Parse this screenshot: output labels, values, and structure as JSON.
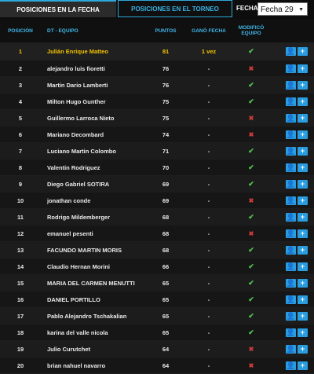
{
  "tabs": [
    {
      "label": "POSICIONES EN LA FECHA",
      "active": true
    },
    {
      "label": "POSICIONES EN EL TORNEO",
      "active": false
    }
  ],
  "fecha": {
    "label": "FECHA:",
    "selected": "Fecha 29"
  },
  "columns": {
    "posicion": "POSICIÓN",
    "equipo": "DT - EQUIPO",
    "puntos": "PUNTOS",
    "gano_fecha": "GANÓ FECHA",
    "modifico_equipo": "MODIFICÓ EQUIPO"
  },
  "colors": {
    "accent": "#2ea7d9",
    "leader": "#f2c200",
    "check": "#4ec54e",
    "cross": "#d23a3a"
  },
  "rows": [
    {
      "pos": "1",
      "name": "Julián Enrique Matteo",
      "pts": "81",
      "gano": "1 vez",
      "mod": "check"
    },
    {
      "pos": "2",
      "name": "alejandro luis fioretti",
      "pts": "76",
      "gano": "-",
      "mod": "cross"
    },
    {
      "pos": "3",
      "name": "Martin Dario Lamberti",
      "pts": "76",
      "gano": "-",
      "mod": "check"
    },
    {
      "pos": "4",
      "name": "Milton Hugo Gunther",
      "pts": "75",
      "gano": "-",
      "mod": "check"
    },
    {
      "pos": "5",
      "name": "Guillermo Larroca Nieto",
      "pts": "75",
      "gano": "-",
      "mod": "cross"
    },
    {
      "pos": "6",
      "name": "Mariano Decombard",
      "pts": "74",
      "gano": "-",
      "mod": "cross"
    },
    {
      "pos": "7",
      "name": "Luciano Martin Colombo",
      "pts": "71",
      "gano": "-",
      "mod": "check"
    },
    {
      "pos": "8",
      "name": "Valentin Rodriguez",
      "pts": "70",
      "gano": "-",
      "mod": "check"
    },
    {
      "pos": "9",
      "name": "Diego Gabriel SOTIRA",
      "pts": "69",
      "gano": "-",
      "mod": "check"
    },
    {
      "pos": "10",
      "name": "jonathan conde",
      "pts": "69",
      "gano": "-",
      "mod": "cross"
    },
    {
      "pos": "11",
      "name": "Rodrigo Mildemberger",
      "pts": "68",
      "gano": "-",
      "mod": "check"
    },
    {
      "pos": "12",
      "name": "emanuel pesenti",
      "pts": "68",
      "gano": "-",
      "mod": "cross"
    },
    {
      "pos": "13",
      "name": "FACUNDO MARTIN MORIS",
      "pts": "68",
      "gano": "-",
      "mod": "check"
    },
    {
      "pos": "14",
      "name": "Claudio Hernan Morini",
      "pts": "66",
      "gano": "-",
      "mod": "check"
    },
    {
      "pos": "15",
      "name": "MARIA DEL CARMEN MENUTTI",
      "pts": "65",
      "gano": "-",
      "mod": "check"
    },
    {
      "pos": "16",
      "name": "DANIEL PORTILLO",
      "pts": "65",
      "gano": "-",
      "mod": "check"
    },
    {
      "pos": "17",
      "name": "Pablo Alejandro Tschakalian",
      "pts": "65",
      "gano": "-",
      "mod": "check"
    },
    {
      "pos": "18",
      "name": "karina del valle nicola",
      "pts": "65",
      "gano": "-",
      "mod": "check"
    },
    {
      "pos": "19",
      "name": "Julio Curutchet",
      "pts": "64",
      "gano": "-",
      "mod": "cross"
    },
    {
      "pos": "20",
      "name": "brian nahuel navarro",
      "pts": "64",
      "gano": "-",
      "mod": "cross"
    }
  ]
}
